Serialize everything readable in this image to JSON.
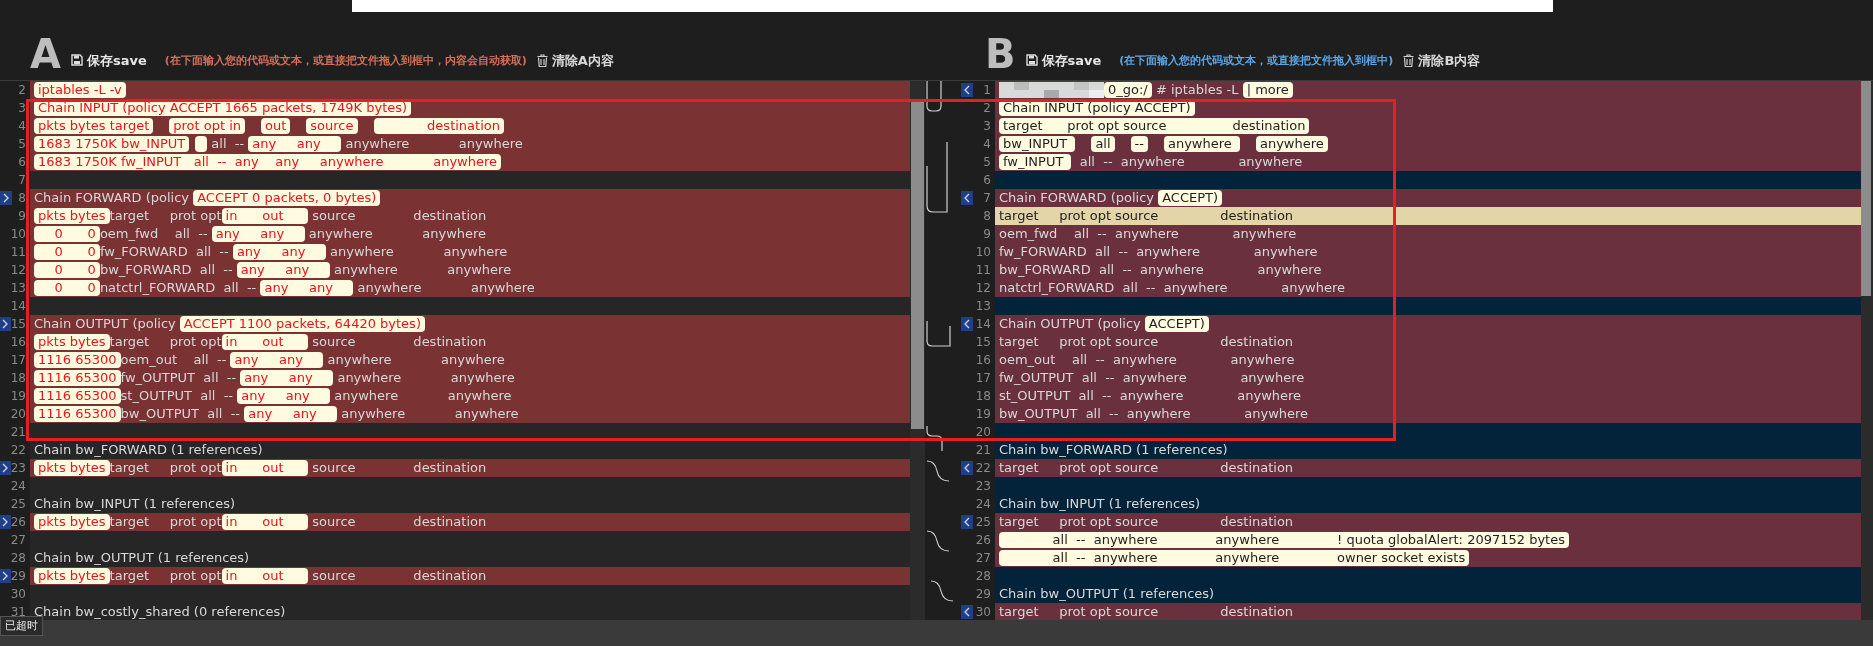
{
  "panes": [
    {
      "letter": "A",
      "save_label": "保存save",
      "hint": "(在下面输入您的代码或文本，或直接把文件拖入到框中，内容会自动获取)",
      "clear_label": "清除A内容",
      "lines": [
        {
          "number": "2",
          "kind": "changed",
          "marker": false,
          "segments": [
            {
              "text": "iptables -L -v",
              "highlight": true
            }
          ]
        },
        {
          "number": "3",
          "kind": "changed",
          "marker": false,
          "segments": [
            {
              "text": "Chain INPUT (policy ACCEPT 1665 packets, 1749K bytes)",
              "highlight": true
            }
          ]
        },
        {
          "number": "4",
          "kind": "changed",
          "marker": false,
          "segments": [
            {
              "text": "pkts bytes target",
              "highlight": true
            },
            {
              "text": "prot opt in",
              "highlight": true
            },
            {
              "text": "out",
              "highlight": true
            },
            {
              "text": "source",
              "highlight": true
            },
            {
              "text": "            destination",
              "highlight": true
            }
          ]
        },
        {
          "number": "5",
          "kind": "changed",
          "marker": false,
          "segments": [
            {
              "text": "1683 1750K bw_INPUT",
              "highlight": true
            },
            {
              "highlight": true
            },
            {
              "text": " all  -- ",
              "highlight": false
            },
            {
              "text": "any     any    ",
              "highlight": true
            },
            {
              "text": " anywhere            anywhere",
              "highlight": false
            }
          ]
        },
        {
          "number": "6",
          "kind": "changed",
          "marker": false,
          "segments": [
            {
              "text": "1683 1750K fw_INPUT   all  --  any    any     anywhere            anywhere",
              "highlight": true
            }
          ]
        },
        {
          "number": "7",
          "kind": "same",
          "marker": false
        },
        {
          "number": "8",
          "kind": "changed",
          "marker": true,
          "segments": [
            {
              "text": "Chain FORWARD (policy ",
              "highlight": false
            },
            {
              "text": "ACCEPT 0 packets, 0 bytes)",
              "highlight": true
            }
          ]
        },
        {
          "number": "9",
          "kind": "changed",
          "marker": false,
          "segments": [
            {
              "text": "pkts bytes",
              "highlight": true
            },
            {
              "text": "target     prot opt",
              "highlight": false
            },
            {
              "text": "in      out     ",
              "highlight": true
            },
            {
              "text": " source              destination",
              "highlight": false
            }
          ]
        },
        {
          "number": "10",
          "kind": "changed",
          "marker": false,
          "segments": [
            {
              "text": "    0      0",
              "highlight": true
            },
            {
              "text": "oem_fwd    all  -- ",
              "highlight": false
            },
            {
              "text": "any     any    ",
              "highlight": true
            },
            {
              "text": " anywhere            anywhere",
              "highlight": false
            }
          ]
        },
        {
          "number": "11",
          "kind": "changed",
          "marker": false,
          "segments": [
            {
              "text": "    0      0",
              "highlight": true
            },
            {
              "text": "fw_FORWARD  all  -- ",
              "highlight": false
            },
            {
              "text": "any     any    ",
              "highlight": true
            },
            {
              "text": " anywhere            anywhere",
              "highlight": false
            }
          ]
        },
        {
          "number": "12",
          "kind": "changed",
          "marker": false,
          "segments": [
            {
              "text": "    0      0",
              "highlight": true
            },
            {
              "text": "bw_FORWARD  all  -- ",
              "highlight": false
            },
            {
              "text": "any     any    ",
              "highlight": true
            },
            {
              "text": " anywhere            anywhere",
              "highlight": false
            }
          ]
        },
        {
          "number": "13",
          "kind": "changed",
          "marker": false,
          "segments": [
            {
              "text": "    0      0",
              "highlight": true
            },
            {
              "text": "natctrl_FORWARD  all  -- ",
              "highlight": false
            },
            {
              "text": "any     any    ",
              "highlight": true
            },
            {
              "text": " anywhere            anywhere",
              "highlight": false
            }
          ]
        },
        {
          "number": "14",
          "kind": "same",
          "marker": false
        },
        {
          "number": "15",
          "kind": "changed",
          "marker": true,
          "segments": [
            {
              "text": "Chain OUTPUT (policy ",
              "highlight": false
            },
            {
              "text": "ACCEPT 1100 packets, 64420 bytes)",
              "highlight": true
            }
          ]
        },
        {
          "number": "16",
          "kind": "changed",
          "marker": false,
          "segments": [
            {
              "text": "pkts bytes",
              "highlight": true
            },
            {
              "text": "target     prot opt",
              "highlight": false
            },
            {
              "text": "in      out     ",
              "highlight": true
            },
            {
              "text": " source              destination",
              "highlight": false
            }
          ]
        },
        {
          "number": "17",
          "kind": "changed",
          "marker": false,
          "segments": [
            {
              "text": "1116 65300",
              "highlight": true
            },
            {
              "text": "oem_out    all  -- ",
              "highlight": false
            },
            {
              "text": "any     any    ",
              "highlight": true
            },
            {
              "text": " anywhere            anywhere",
              "highlight": false
            }
          ]
        },
        {
          "number": "18",
          "kind": "changed",
          "marker": false,
          "segments": [
            {
              "text": "1116 65300",
              "highlight": true
            },
            {
              "text": "fw_OUTPUT  all  -- ",
              "highlight": false
            },
            {
              "text": "any     any    ",
              "highlight": true
            },
            {
              "text": " anywhere            anywhere",
              "highlight": false
            }
          ]
        },
        {
          "number": "19",
          "kind": "changed",
          "marker": false,
          "segments": [
            {
              "text": "1116 65300",
              "highlight": true
            },
            {
              "text": "st_OUTPUT  all  -- ",
              "highlight": false
            },
            {
              "text": "any     any    ",
              "highlight": true
            },
            {
              "text": " anywhere            anywhere",
              "highlight": false
            }
          ]
        },
        {
          "number": "20",
          "kind": "changed",
          "marker": false,
          "segments": [
            {
              "text": "1116 65300",
              "highlight": true
            },
            {
              "text": "bw_OUTPUT  all  -- ",
              "highlight": false
            },
            {
              "text": "any     any    ",
              "highlight": true
            },
            {
              "text": " anywhere            anywhere",
              "highlight": false
            }
          ]
        },
        {
          "number": "21",
          "kind": "same",
          "marker": false
        },
        {
          "number": "22",
          "kind": "same",
          "marker": false,
          "segments": [
            {
              "text": "Chain bw_FORWARD (1 references)",
              "highlight": false
            }
          ]
        },
        {
          "number": "23",
          "kind": "changed",
          "marker": true,
          "segments": [
            {
              "text": "pkts bytes",
              "highlight": true
            },
            {
              "text": "target     prot opt",
              "highlight": false
            },
            {
              "text": "in      out     ",
              "highlight": true
            },
            {
              "text": " source              destination",
              "highlight": false
            }
          ]
        },
        {
          "number": "24",
          "kind": "same",
          "marker": false
        },
        {
          "number": "25",
          "kind": "same",
          "marker": false,
          "segments": [
            {
              "text": "Chain bw_INPUT (1 references)",
              "highlight": false
            }
          ]
        },
        {
          "number": "26",
          "kind": "changed",
          "marker": true,
          "segments": [
            {
              "text": "pkts bytes",
              "highlight": true
            },
            {
              "text": "target     prot opt",
              "highlight": false
            },
            {
              "text": "in      out     ",
              "highlight": true
            },
            {
              "text": " source              destination",
              "highlight": false
            }
          ]
        },
        {
          "number": "27",
          "kind": "same",
          "marker": false
        },
        {
          "number": "28",
          "kind": "same",
          "marker": false,
          "segments": [
            {
              "text": "Chain bw_OUTPUT (1 references)",
              "highlight": false
            }
          ]
        },
        {
          "number": "29",
          "kind": "changed",
          "marker": true,
          "segments": [
            {
              "text": "pkts bytes",
              "highlight": true
            },
            {
              "text": "target     prot opt",
              "highlight": false
            },
            {
              "text": "in      out     ",
              "highlight": true
            },
            {
              "text": " source              destination",
              "highlight": false
            }
          ]
        },
        {
          "number": "30",
          "kind": "same",
          "marker": false
        },
        {
          "number": "31",
          "kind": "same",
          "marker": false,
          "segments": [
            {
              "text": "Chain bw_costly_shared (0 references)",
              "highlight": false
            }
          ]
        }
      ]
    },
    {
      "letter": "B",
      "save_label": "保存save",
      "hint": "(在下面输入您的代码或文本，或直接把文件拖入到框中)",
      "clear_label": "清除B内容",
      "lines": [
        {
          "number": "1",
          "kind": "changed",
          "marker": true,
          "redacted": true,
          "segments": [
            {
              "text": "0_go:/",
              "highlight": true
            },
            {
              "text": " # iptables -L ",
              "highlight": false
            },
            {
              "text": "| more",
              "highlight": true
            }
          ]
        },
        {
          "number": "2",
          "kind": "changed",
          "marker": false,
          "segments": [
            {
              "text": "Chain INPUT (policy ACCEPT)",
              "highlight": true
            }
          ]
        },
        {
          "number": "3",
          "kind": "changed",
          "marker": false,
          "segments": [
            {
              "text": "target      prot opt source                destination",
              "highlight": true
            }
          ]
        },
        {
          "number": "4",
          "kind": "changed",
          "marker": false,
          "segments": [
            {
              "text": "bw_INPUT ",
              "highlight": true
            },
            {
              "text": "all",
              "highlight": true
            },
            {
              "text": "--",
              "highlight": true
            },
            {
              "text": "anywhere ",
              "highlight": true
            },
            {
              "text": "anywhere",
              "highlight": true
            }
          ]
        },
        {
          "number": "5",
          "kind": "changed",
          "marker": false,
          "segments": [
            {
              "text": "fw_INPUT ",
              "highlight": true
            },
            {
              "text": "  all  --  anywhere             anywhere",
              "highlight": false
            }
          ]
        },
        {
          "number": "6",
          "kind": "same",
          "marker": false
        },
        {
          "number": "7",
          "kind": "changed",
          "marker": true,
          "segments": [
            {
              "text": "Chain FORWARD (policy ",
              "highlight": false
            },
            {
              "text": "ACCEPT)",
              "highlight": true
            }
          ]
        },
        {
          "number": "8",
          "kind": "current",
          "marker": false,
          "segments": [
            {
              "text": "target     prot opt source               destination",
              "highlight": false
            }
          ]
        },
        {
          "number": "9",
          "kind": "changed",
          "marker": false,
          "segments": [
            {
              "text": "oem_fwd    all  --  anywhere             anywhere",
              "highlight": false
            }
          ]
        },
        {
          "number": "10",
          "kind": "changed",
          "marker": false,
          "segments": [
            {
              "text": "fw_FORWARD  all  --  anywhere             anywhere",
              "highlight": false
            }
          ]
        },
        {
          "number": "11",
          "kind": "changed",
          "marker": false,
          "segments": [
            {
              "text": "bw_FORWARD  all  --  anywhere             anywhere",
              "highlight": false
            }
          ]
        },
        {
          "number": "12",
          "kind": "changed",
          "marker": false,
          "segments": [
            {
              "text": "natctrl_FORWARD  all  --  anywhere             anywhere",
              "highlight": false
            }
          ]
        },
        {
          "number": "13",
          "kind": "same",
          "marker": false
        },
        {
          "number": "14",
          "kind": "changed",
          "marker": true,
          "segments": [
            {
              "text": "Chain OUTPUT (policy ",
              "highlight": false
            },
            {
              "text": "ACCEPT)",
              "highlight": true
            }
          ]
        },
        {
          "number": "15",
          "kind": "changed",
          "marker": false,
          "segments": [
            {
              "text": "target     prot opt source               destination",
              "highlight": false
            }
          ]
        },
        {
          "number": "16",
          "kind": "changed",
          "marker": false,
          "segments": [
            {
              "text": "oem_out    all  --  anywhere             anywhere",
              "highlight": false
            }
          ]
        },
        {
          "number": "17",
          "kind": "changed",
          "marker": false,
          "segments": [
            {
              "text": "fw_OUTPUT  all  --  anywhere             anywhere",
              "highlight": false
            }
          ]
        },
        {
          "number": "18",
          "kind": "changed",
          "marker": false,
          "segments": [
            {
              "text": "st_OUTPUT  all  --  anywhere             anywhere",
              "highlight": false
            }
          ]
        },
        {
          "number": "19",
          "kind": "changed",
          "marker": false,
          "segments": [
            {
              "text": "bw_OUTPUT  all  --  anywhere             anywhere",
              "highlight": false
            }
          ]
        },
        {
          "number": "20",
          "kind": "same",
          "marker": false
        },
        {
          "number": "21",
          "kind": "same",
          "marker": false,
          "segments": [
            {
              "text": "Chain bw_FORWARD (1 references)",
              "highlight": false
            }
          ]
        },
        {
          "number": "22",
          "kind": "changed",
          "marker": true,
          "segments": [
            {
              "text": "target     prot opt source               destination",
              "highlight": false
            }
          ]
        },
        {
          "number": "23",
          "kind": "same",
          "marker": false
        },
        {
          "number": "24",
          "kind": "same",
          "marker": false,
          "segments": [
            {
              "text": "Chain bw_INPUT (1 references)",
              "highlight": false
            }
          ]
        },
        {
          "number": "25",
          "kind": "changed",
          "marker": true,
          "segments": [
            {
              "text": "target     prot opt source               destination",
              "highlight": false
            }
          ]
        },
        {
          "number": "26",
          "kind": "changed",
          "marker": false,
          "segments": [
            {
              "text": "            all  --  anywhere              anywhere              ! quota globalAlert: 2097152 bytes",
              "highlight": true
            }
          ]
        },
        {
          "number": "27",
          "kind": "changed",
          "marker": false,
          "segments": [
            {
              "text": "            all  --  anywhere              anywhere              owner socket exists",
              "highlight": true
            }
          ]
        },
        {
          "number": "28",
          "kind": "same",
          "marker": false
        },
        {
          "number": "29",
          "kind": "same",
          "marker": false,
          "segments": [
            {
              "text": "Chain bw_OUTPUT (1 references)",
              "highlight": false
            }
          ]
        },
        {
          "number": "30",
          "kind": "changed",
          "marker": true,
          "segments": [
            {
              "text": "target     prot opt source               destination",
              "highlight": false
            }
          ]
        }
      ]
    }
  ],
  "tooltip": "已超时"
}
